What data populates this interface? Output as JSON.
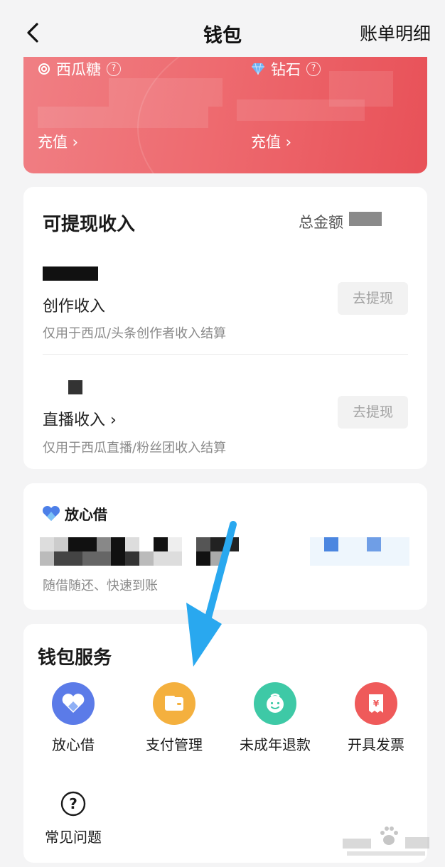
{
  "header": {
    "title": "钱包",
    "right_link": "账单明细"
  },
  "balance": {
    "left": {
      "label": "西瓜糖",
      "topup": "充值 ›"
    },
    "right": {
      "label": "钻石",
      "topup": "充值 ›"
    }
  },
  "income": {
    "title": "可提现收入",
    "total_label": "总金额",
    "items": [
      {
        "name": "创作收入",
        "desc": "仅用于西瓜/头条创作者收入结算",
        "button": "去提现"
      },
      {
        "name": "直播收入 ›",
        "desc": "仅用于西瓜直播/粉丝团收入结算",
        "button": "去提现"
      }
    ]
  },
  "loan": {
    "title": "放心借",
    "desc": "随借随还、快速到账"
  },
  "services": {
    "title": "钱包服务",
    "items": [
      {
        "label": "放心借",
        "icon": "fangxinjie-icon",
        "color": "#5b7be8"
      },
      {
        "label": "支付管理",
        "icon": "wallet-icon",
        "color": "#f4b03e"
      },
      {
        "label": "未成年退款",
        "icon": "child-face-icon",
        "color": "#3ec9a6"
      },
      {
        "label": "开具发票",
        "icon": "invoice-icon",
        "color": "#ef5a5a"
      },
      {
        "label": "常见问题",
        "icon": "question-circle-icon",
        "color": "#1a1a1a"
      }
    ]
  },
  "colors": {
    "accent_red": "#ee6b70",
    "arrow_blue": "#29a8ef"
  }
}
